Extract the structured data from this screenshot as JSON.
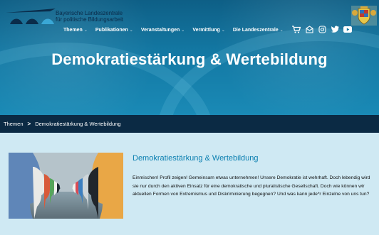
{
  "header": {
    "org_line1": "Bayerische Landeszentrale",
    "org_line2": "für politische Bildungsarbeit"
  },
  "nav": {
    "items": [
      {
        "label": "Themen"
      },
      {
        "label": "Publikationen"
      },
      {
        "label": "Veranstaltungen"
      },
      {
        "label": "Vermittlung"
      },
      {
        "label": "Die Landeszentrale"
      }
    ],
    "icons": [
      "cart-icon",
      "mail-icon",
      "instagram-icon",
      "twitter-icon",
      "youtube-icon"
    ]
  },
  "hero": {
    "title": "Demokratiestärkung & Wertebildung"
  },
  "breadcrumb": {
    "root": "Themen",
    "separator": ">",
    "current": "Demokratiestärkung & Wertebildung"
  },
  "teaser": {
    "title": "Demokratiestärkung & Wertebildung",
    "text": "Einmischen! Profil zeigen! Gemeinsam etwas unternehmen! Unsere Demokratie ist wehrhaft. Doch lebendig wird sie nur durch den aktiven Einsatz für eine demokratische und pluralistische Gesellschaft. Doch wie können wir aktuellen Formen von Extremismus und Diskriminierung begegnen? Und was kann jede*r Einzelne von uns tun?"
  },
  "colors": {
    "hero_top": "#0e5f86",
    "hero_bottom": "#1a8ab6",
    "breadcrumb_bg": "#0b2a44",
    "content_bg": "#cfe9f3",
    "accent_title": "#0b7fb0"
  }
}
